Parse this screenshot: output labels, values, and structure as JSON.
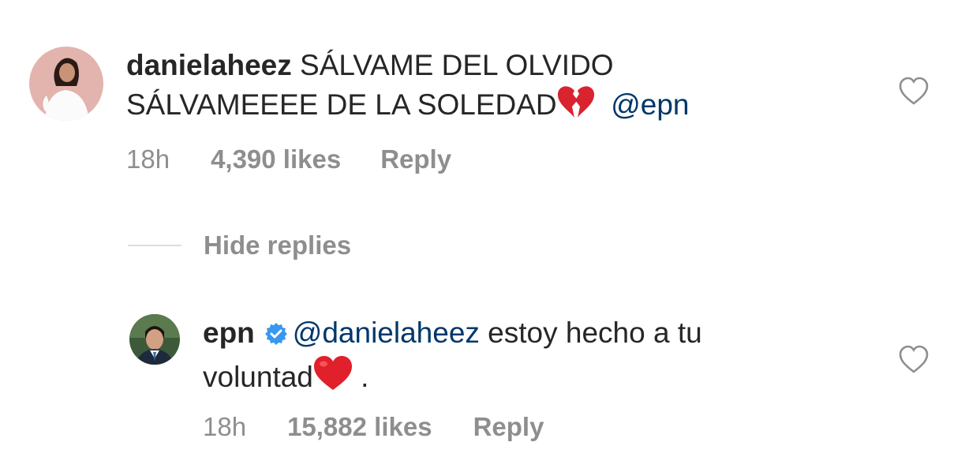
{
  "comment": {
    "username": "danielaheez",
    "text_line1": "SÁLVAME DEL OLVIDO",
    "text_line2": "SÁLVAMEEEE DE LA SOLEDAD",
    "mention": "@epn",
    "time": "18h",
    "likes": "4,390 likes",
    "reply_label": "Reply"
  },
  "hide_replies_label": "Hide replies",
  "reply": {
    "username": "epn",
    "verified": true,
    "mention": "@danielaheez",
    "text_part1": " estoy hecho a tu",
    "text_part2": "voluntad",
    "text_end": " .",
    "time": "18h",
    "likes": "15,882 likes",
    "reply_label": "Reply"
  },
  "colors": {
    "text": "#262626",
    "mention": "#00376b",
    "meta": "#8e8e8e",
    "verified": "#3897f0",
    "heart_emoji": "#e0202a"
  },
  "icons": [
    "broken-heart-emoji",
    "heart-outline-icon",
    "verified-badge-icon",
    "red-heart-emoji"
  ]
}
